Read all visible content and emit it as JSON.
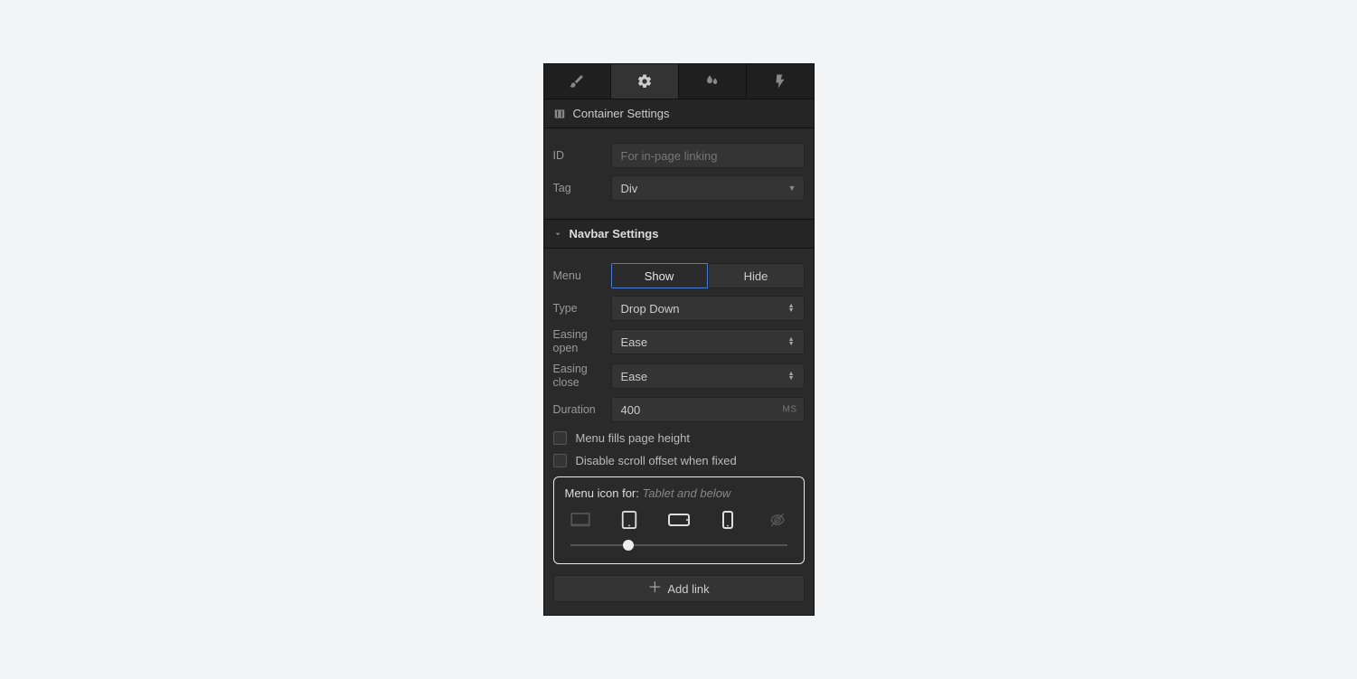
{
  "tabs": {
    "style": "style",
    "settings": "settings",
    "effects": "effects",
    "interactions": "interactions",
    "active": "settings"
  },
  "container_section": {
    "title": "Container Settings",
    "id_label": "ID",
    "id_placeholder": "For in-page linking",
    "id_value": "",
    "tag_label": "Tag",
    "tag_value": "Div"
  },
  "navbar_section": {
    "title": "Navbar Settings",
    "menu_label": "Menu",
    "menu_show": "Show",
    "menu_hide": "Hide",
    "menu_active": "Show",
    "type_label": "Type",
    "type_value": "Drop Down",
    "easing_open_label": "Easing open",
    "easing_open_value": "Ease",
    "easing_close_label": "Easing close",
    "easing_close_value": "Ease",
    "duration_label": "Duration",
    "duration_value": "400",
    "duration_unit": "MS",
    "check_fill": "Menu fills page height",
    "check_scroll": "Disable scroll offset when fixed",
    "menu_icon_prefix": "Menu icon for:",
    "menu_icon_state": "Tablet and below",
    "add_link": "Add link"
  }
}
